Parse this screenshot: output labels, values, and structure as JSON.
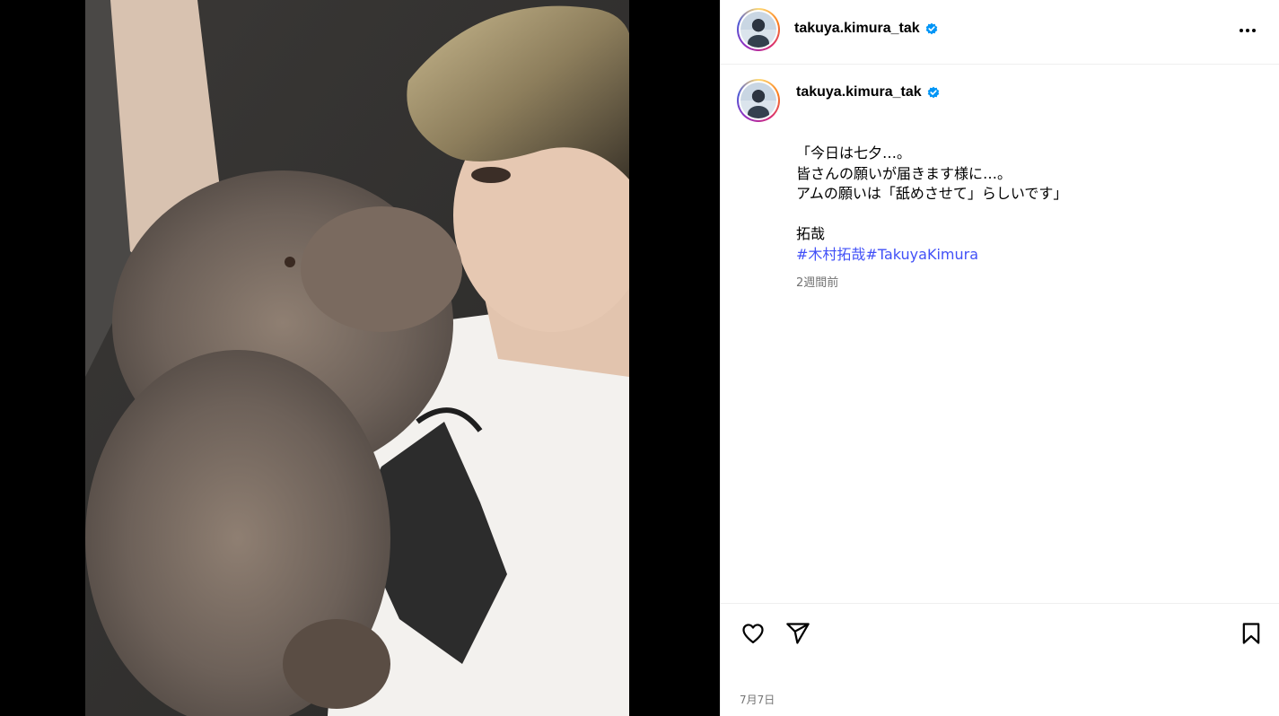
{
  "post": {
    "username": "takuya.kimura_tak",
    "verified": true,
    "more_icon": "more-horizontal-icon",
    "caption": {
      "lines": [
        "「今日は七夕…。",
        "皆さんの願いが届きます様に…。",
        "アムの願いは「舐めさせて」らしいです」",
        "",
        "拓哉"
      ],
      "hashtags": [
        "#木村拓哉",
        "#TakuyaKimura"
      ]
    },
    "time_ago": "2週間前",
    "date": "7月7日",
    "actions": {
      "like_icon": "heart-icon",
      "share_icon": "paper-plane-icon",
      "save_icon": "bookmark-icon"
    }
  },
  "colors": {
    "link": "#4150f7",
    "verified": "#0095f6",
    "muted": "#737373",
    "divider": "#efefef"
  }
}
